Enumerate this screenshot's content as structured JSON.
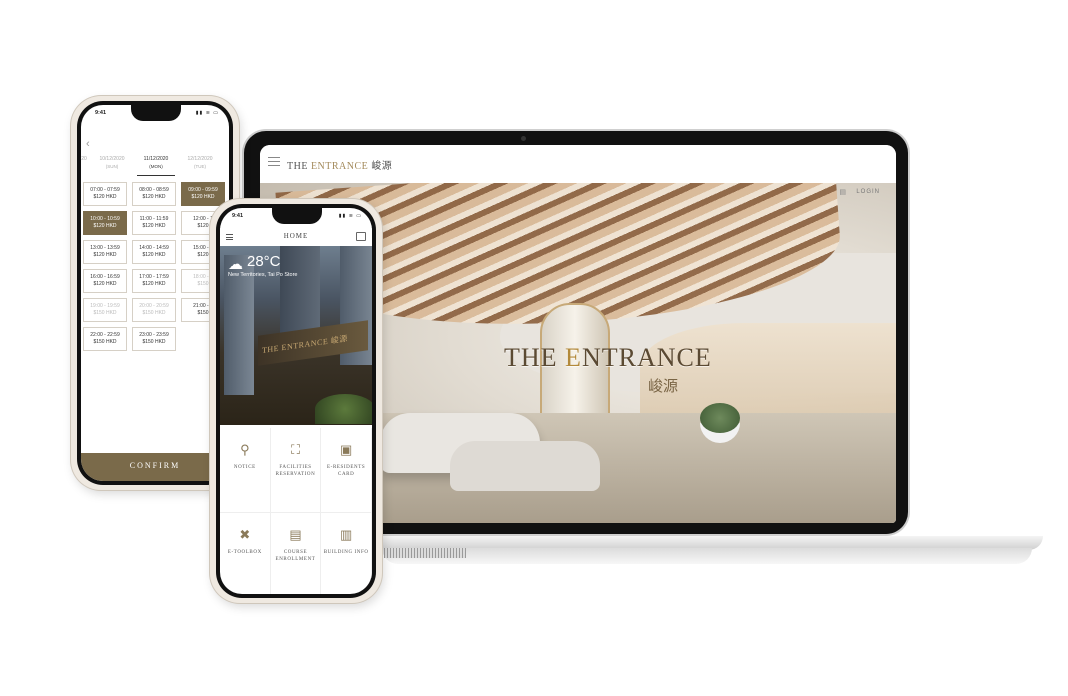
{
  "laptop": {
    "header": {
      "logo_main": "THE",
      "logo_accent": "ENTRANCE",
      "logo_cn": "峻源",
      "user_icon": "user-icon",
      "login_label": "LOGIN"
    },
    "hero": {
      "logo_main": "THE",
      "logo_accent": "E",
      "logo_rest": "NTRANCE",
      "logo_cn": "峻源"
    }
  },
  "booking_phone": {
    "status_time": "9:41",
    "back_icon": "chevron-left-icon",
    "dates": [
      {
        "date": "10/12/2020",
        "day": "(SUN)",
        "active": false
      },
      {
        "date": "11/12/2020",
        "day": "(MON)",
        "active": true
      },
      {
        "date": "12/12/2020",
        "day": "(TUE)",
        "active": false
      }
    ],
    "slots": [
      [
        {
          "time": "07:00 - 07:59",
          "price": "$120 HKD"
        },
        {
          "time": "08:00 - 08:59",
          "price": "$120 HKD"
        },
        {
          "time": "09:00 - 09:59",
          "price": "$120 HKD",
          "selected": true
        }
      ],
      [
        {
          "time": "10:00 - 10:59",
          "price": "$120 HKD",
          "selected": true
        },
        {
          "time": "11:00 - 11:59",
          "price": "$120 HKD"
        },
        {
          "time": "12:00 - 1",
          "price": "$120"
        }
      ],
      [
        {
          "time": "13:00 - 13:59",
          "price": "$120 HKD"
        },
        {
          "time": "14:00 - 14:59",
          "price": "$120 HKD"
        },
        {
          "time": "15:00 - 1",
          "price": "$120"
        }
      ],
      [
        {
          "time": "16:00 - 16:59",
          "price": "$120 HKD"
        },
        {
          "time": "17:00 - 17:59",
          "price": "$120 HKD"
        },
        {
          "time": "18:00 - 1",
          "price": "$150"
        }
      ],
      [
        {
          "time": "19:00 - 19:59",
          "price": "$150 HKD",
          "dim": true
        },
        {
          "time": "20:00 - 20:59",
          "price": "$150 HKD",
          "dim": true
        },
        {
          "time": "21:00 - 2",
          "price": "$150"
        }
      ],
      [
        {
          "time": "22:00 - 22:59",
          "price": "$150 HKD"
        },
        {
          "time": "23:00 - 23:59",
          "price": "$150 HKD"
        }
      ]
    ],
    "confirm_label": "CONFIRM"
  },
  "home_phone": {
    "status_time": "9:41",
    "title": "HOME",
    "weather": {
      "icon": "partly-cloudy-icon",
      "temperature": "28°C",
      "location": "New Territories, Tai Po Store"
    },
    "sign_text": "THE ENTRANCE 峻源",
    "tiles": [
      {
        "icon": "pin-icon",
        "glyph": "📌",
        "label": "NOTICE"
      },
      {
        "icon": "facilities-icon",
        "glyph": "🏗",
        "label": "FACILITIES RESERVATION"
      },
      {
        "icon": "id-card-icon",
        "glyph": "🪪",
        "label": "E-RESIDENTS CARD"
      },
      {
        "icon": "tools-icon",
        "glyph": "🛠",
        "label": "E-TOOLBOX"
      },
      {
        "icon": "course-icon",
        "glyph": "📋",
        "label": "COURSE ENROLLMENT"
      },
      {
        "icon": "clipboard-icon",
        "glyph": "📄",
        "label": "BUILDING INFO"
      }
    ]
  }
}
